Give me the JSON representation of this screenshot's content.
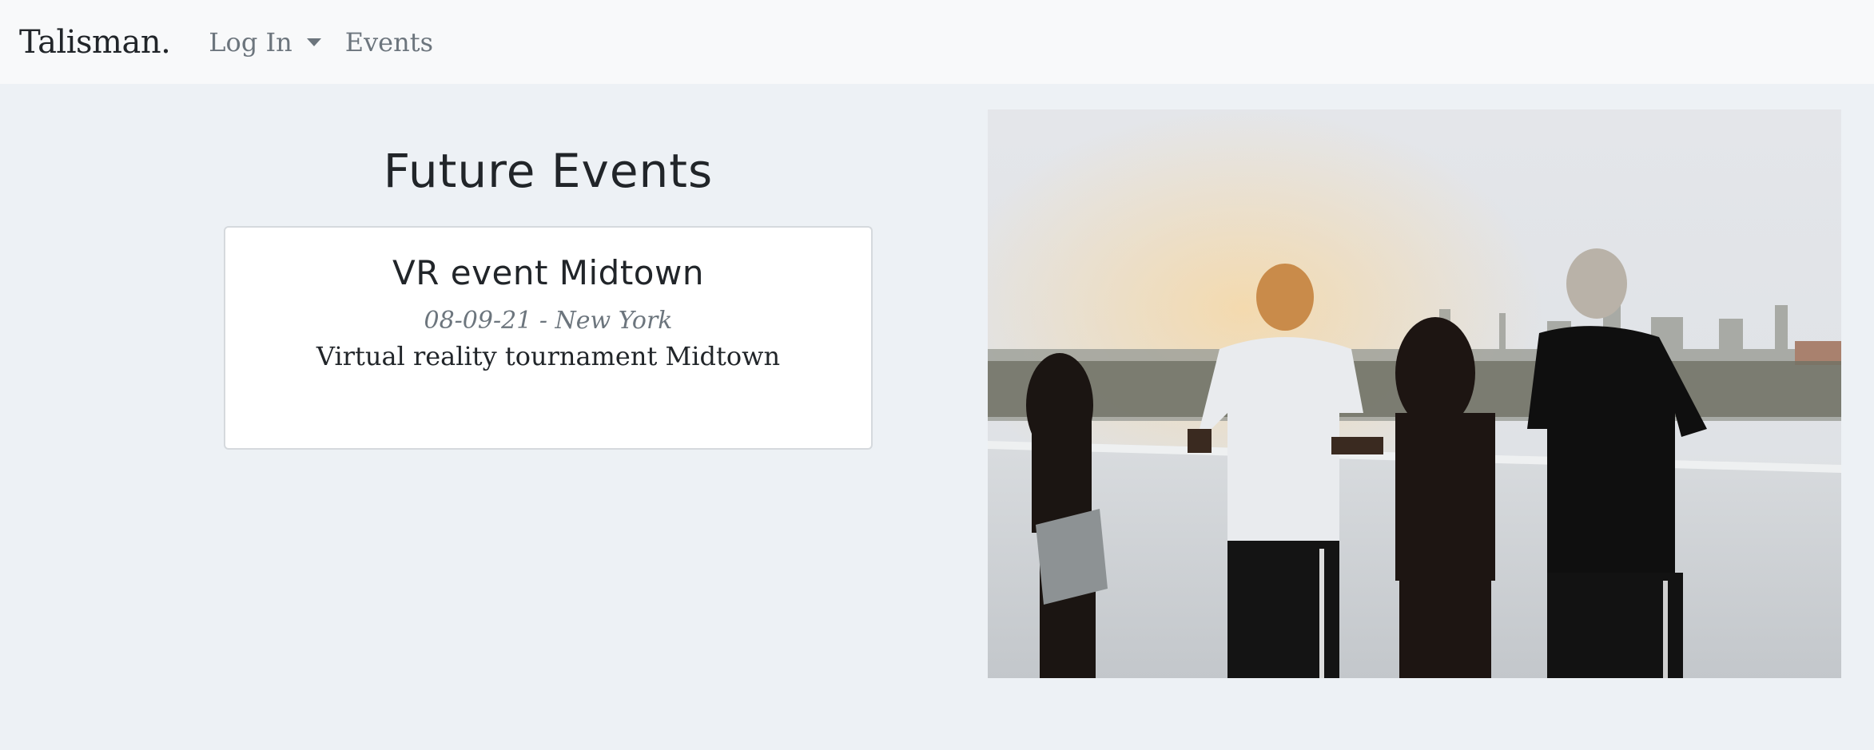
{
  "navbar": {
    "brand": "Talisman.",
    "items": [
      {
        "label": "Log In",
        "dropdown": true
      },
      {
        "label": "Events",
        "dropdown": false
      }
    ]
  },
  "main": {
    "heading": "Future Events",
    "events": [
      {
        "title": "VR event Midtown",
        "subtitle": "08-09-21 - New York",
        "description": "Virtual reality tournament Midtown"
      }
    ]
  },
  "image": {
    "subject": "group-of-friends-on-rooftop-photo"
  },
  "colors": {
    "page_background": "#edf1f5",
    "navbar_background": "#f8f9fa",
    "muted_text": "#6c757d",
    "dark_text": "#212529",
    "card_background": "#ffffff"
  }
}
